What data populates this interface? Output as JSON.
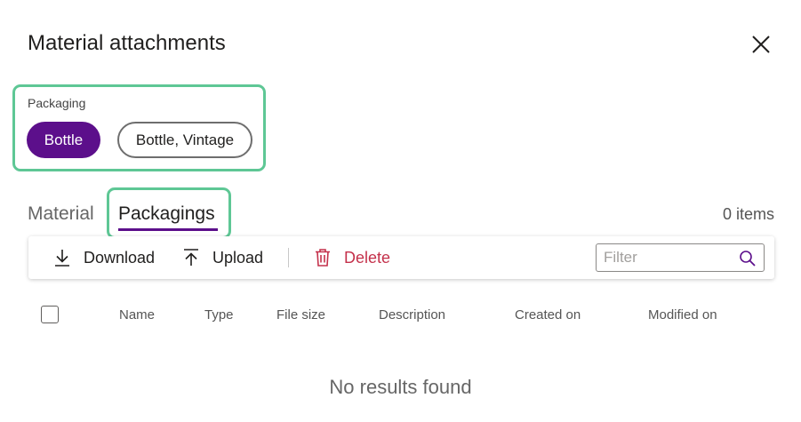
{
  "dialog": {
    "title": "Material attachments",
    "close_icon": "close-icon"
  },
  "packaging": {
    "label": "Packaging",
    "options": [
      {
        "label": "Bottle",
        "selected": true
      },
      {
        "label": "Bottle, Vintage",
        "selected": false
      }
    ]
  },
  "tabs": [
    {
      "label": "Material",
      "active": false
    },
    {
      "label": "Packagings",
      "active": true
    }
  ],
  "count_label": "0 items",
  "toolbar": {
    "download_label": "Download",
    "upload_label": "Upload",
    "delete_label": "Delete"
  },
  "filter": {
    "placeholder": "Filter",
    "value": ""
  },
  "table": {
    "columns": [
      "Name",
      "Type",
      "File size",
      "Description",
      "Created on",
      "Modified on"
    ],
    "rows": []
  },
  "empty_message": "No results found",
  "colors": {
    "accent": "#5c0f8b",
    "delete": "#c4314b",
    "highlight": "#5ec795"
  }
}
